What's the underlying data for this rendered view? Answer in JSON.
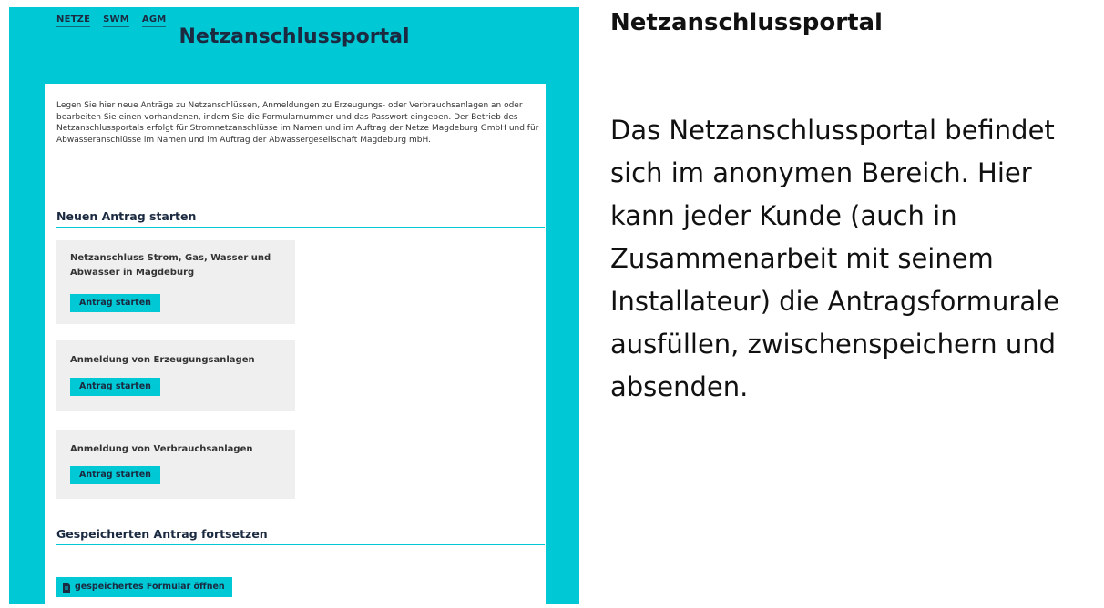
{
  "portal": {
    "logos": [
      "NETZE",
      "SWM",
      "AGM"
    ],
    "title": "Netzanschlussportal",
    "intro": "Legen Sie hier neue Anträge zu Netzanschlüssen, Anmeldungen zu Erzeugungs- oder Verbrauchsanlagen an oder bearbeiten Sie einen vorhandenen, indem Sie die Formularnummer und das Passwort eingeben. Der Betrieb des Netzanschlussportals erfolgt für Stromnetzanschlüsse im Namen und im Auftrag der Netze Magdeburg GmbH und für Abwasseranschlüsse im Namen und im Auftrag der Abwassergesellschaft Magdeburg mbH.",
    "new_section": "Neuen Antrag starten",
    "tiles": [
      {
        "label": "Netzanschluss Strom, Gas, Wasser und Abwasser in Magdeburg",
        "button": "Antrag starten"
      },
      {
        "label": "Anmeldung von Erzeugungsanlagen",
        "button": "Antrag starten"
      },
      {
        "label": "Anmeldung von Verbrauchsanlagen",
        "button": "Antrag starten"
      }
    ],
    "saved_section": "Gespeicherten Antrag fortsetzen",
    "open_saved_button": "gespeichertes Formular öffnen"
  },
  "side": {
    "title": "Netzanschlussportal",
    "body": "Das Netzanschlussportal befindet sich im anonymen Bereich. Hier kann jeder Kunde (auch in Zusammenarbeit mit seinem Installateur) die Antragsformurale ausfüllen, zwischenspeichern und absenden."
  },
  "colors": {
    "accent": "#00c8d5",
    "tile": "#efefef",
    "text_dark": "#1b2a40"
  }
}
